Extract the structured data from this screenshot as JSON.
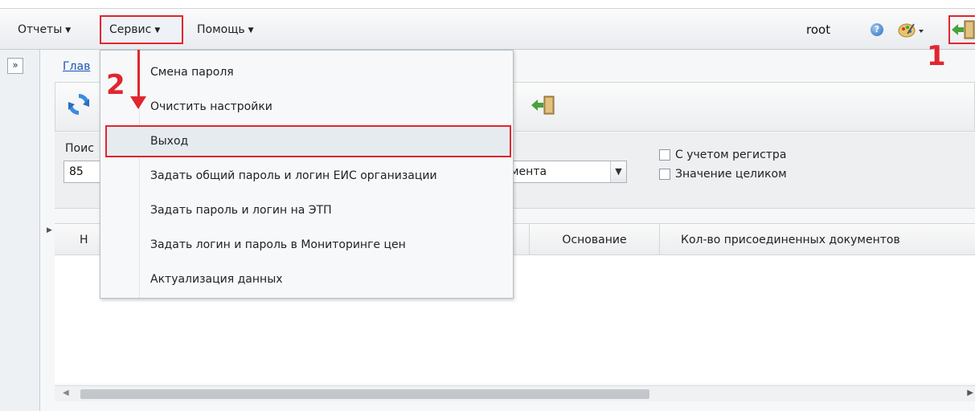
{
  "menubar": {
    "items": [
      {
        "label": "Отчеты"
      },
      {
        "label": "Сервис"
      },
      {
        "label": "Помощь"
      }
    ],
    "user": "root"
  },
  "breadcrumb": "Глав",
  "search": {
    "label": "Поис",
    "value": "85",
    "field_value": "мента",
    "options": [
      "С учетом регистра",
      "Значение целиком"
    ]
  },
  "grid": {
    "columns": [
      "Н",
      "Основание",
      "Кол-во присоединенных документов"
    ]
  },
  "dropdown": {
    "items": [
      "Смена пароля",
      "Очистить настройки",
      "Выход",
      "Задать общий пароль и логин ЕИС организации",
      "Задать пароль и логин на ЭТП",
      "Задать логин и пароль в Мониторинге цен",
      "Актуализация данных"
    ]
  },
  "annotations": {
    "step1": "1",
    "step2": "2"
  },
  "colors": {
    "highlight": "#e0262f",
    "link": "#1a55b5"
  },
  "icons": [
    "help-icon",
    "theme-icon",
    "exit-icon",
    "refresh-icon",
    "expand-icon"
  ]
}
